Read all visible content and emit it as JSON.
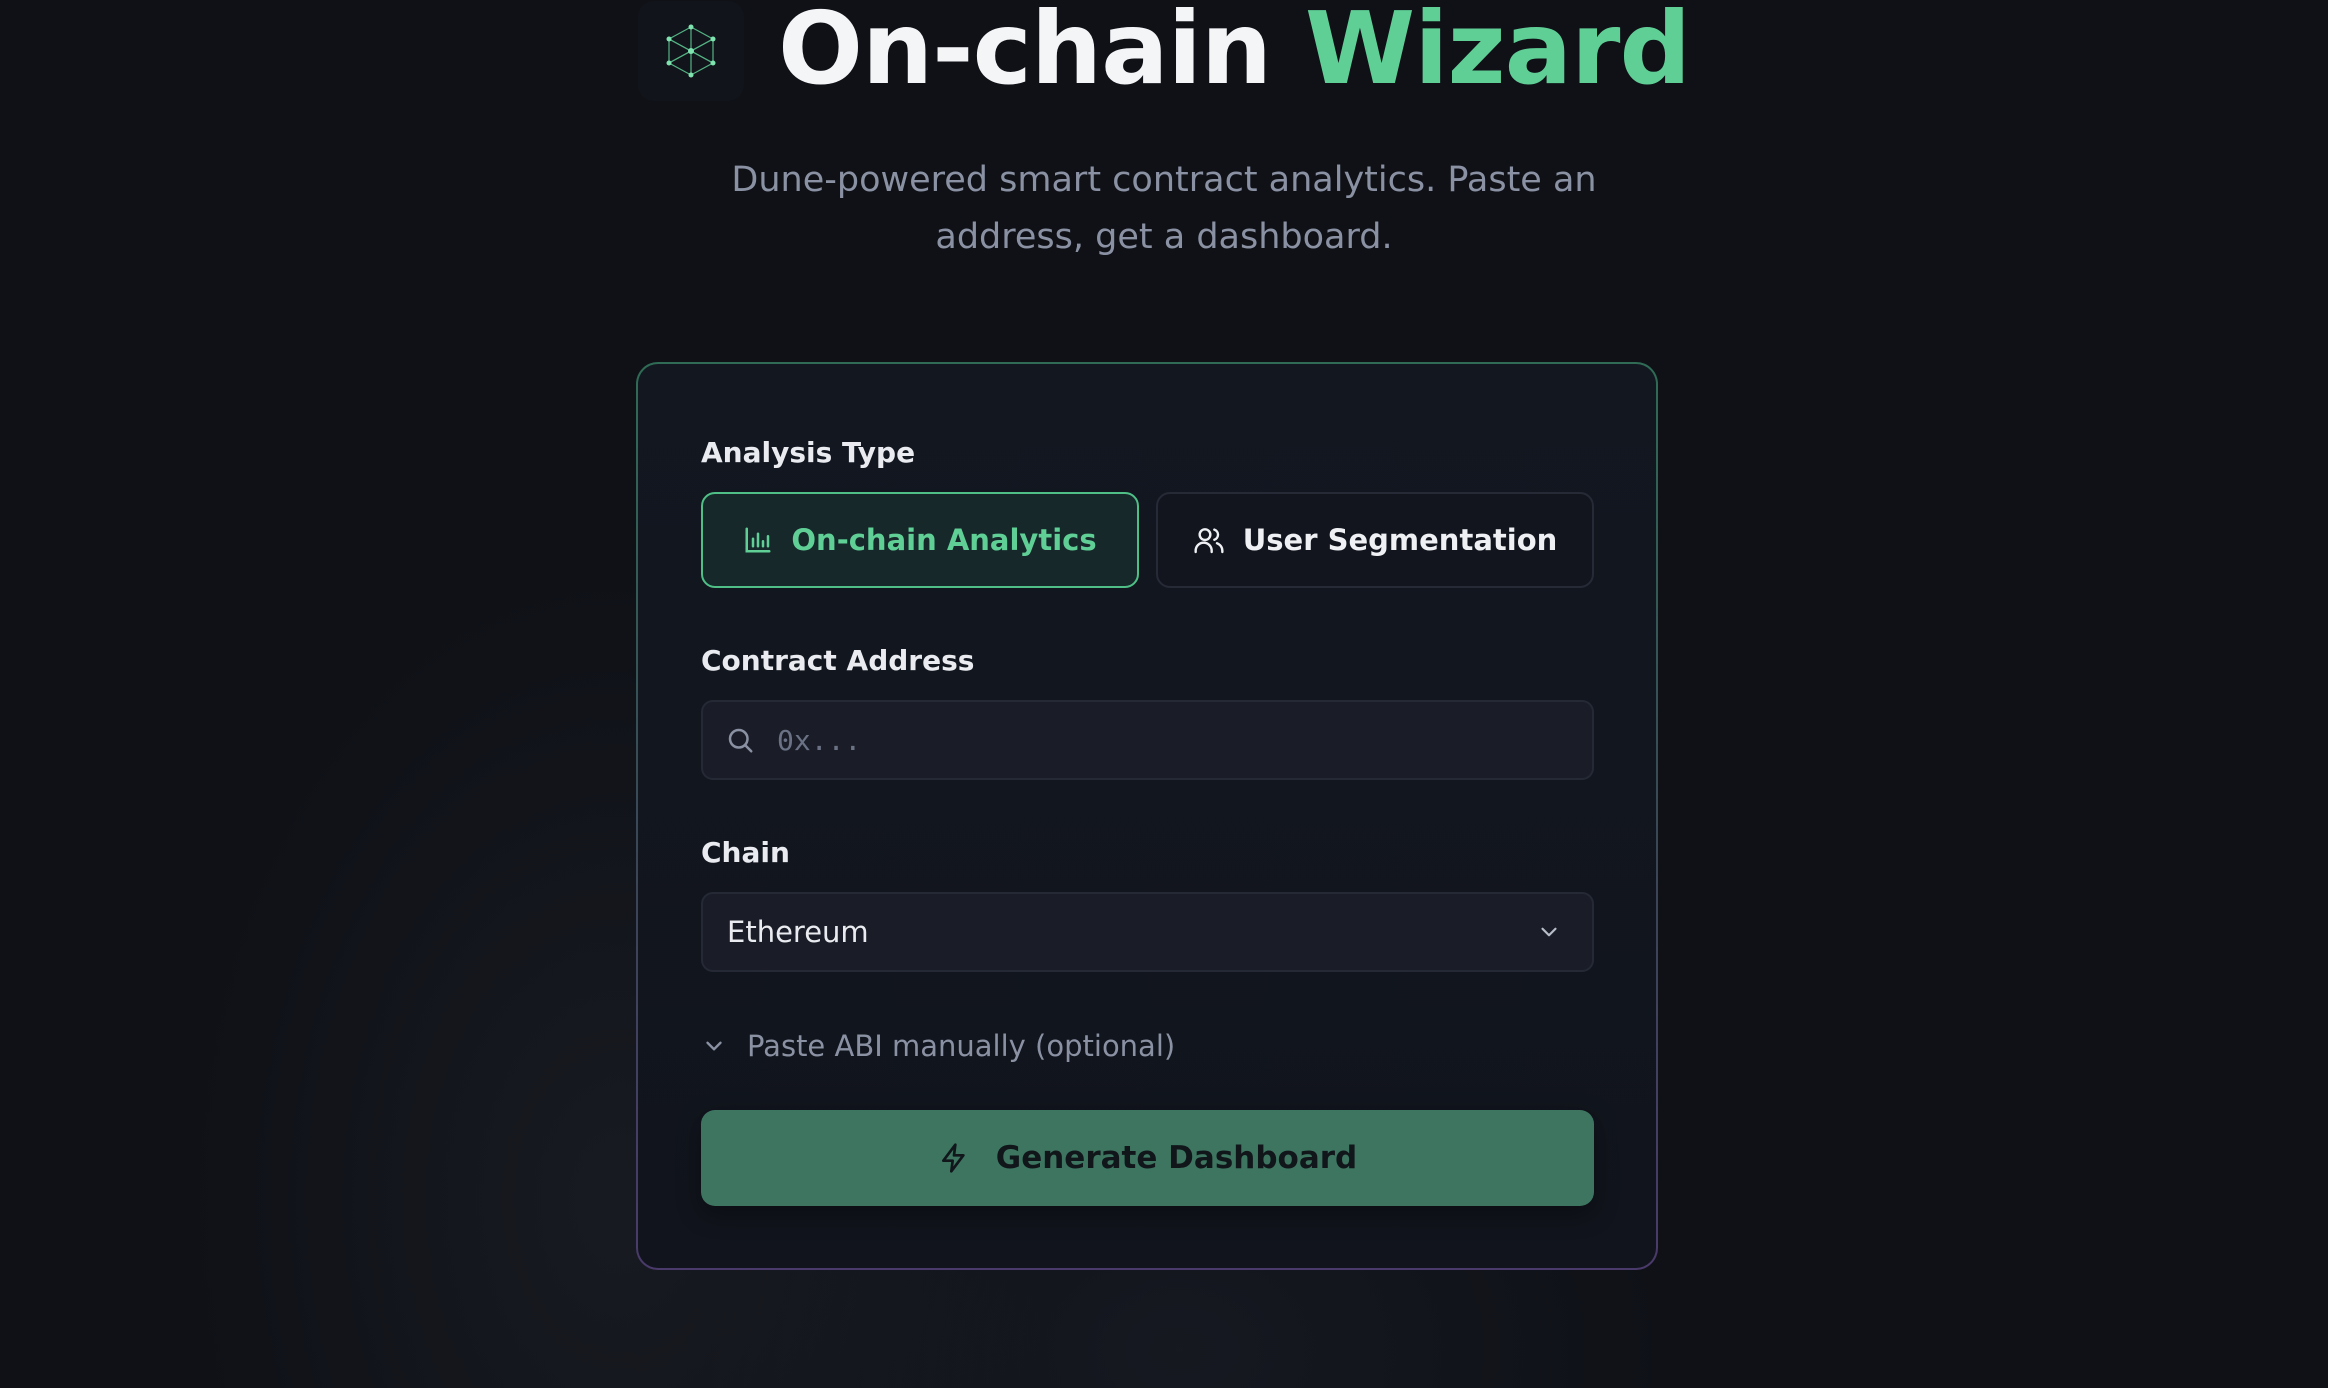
{
  "header": {
    "title_part1": "On-chain",
    "title_part2": "Wizard",
    "logo_icon": "network-cube-icon"
  },
  "subtitle": "Dune-powered smart contract analytics. Paste an address, get a dashboard.",
  "form": {
    "analysis_type_label": "Analysis Type",
    "analysis_options": [
      {
        "label": "On-chain Analytics",
        "icon": "bar-chart-icon",
        "selected": true
      },
      {
        "label": "User Segmentation",
        "icon": "users-icon",
        "selected": false
      }
    ],
    "contract_address_label": "Contract Address",
    "contract_address_value": "",
    "contract_address_placeholder": "0x...",
    "chain_label": "Chain",
    "chain_selected": "Ethereum",
    "abi_toggle_label": "Paste ABI manually (optional)",
    "generate_button_label": "Generate Dashboard"
  },
  "colors": {
    "background": "#0f1117",
    "accent": "#5fcf96",
    "button_green": "#3d7560",
    "muted_text": "#8a91a3"
  }
}
